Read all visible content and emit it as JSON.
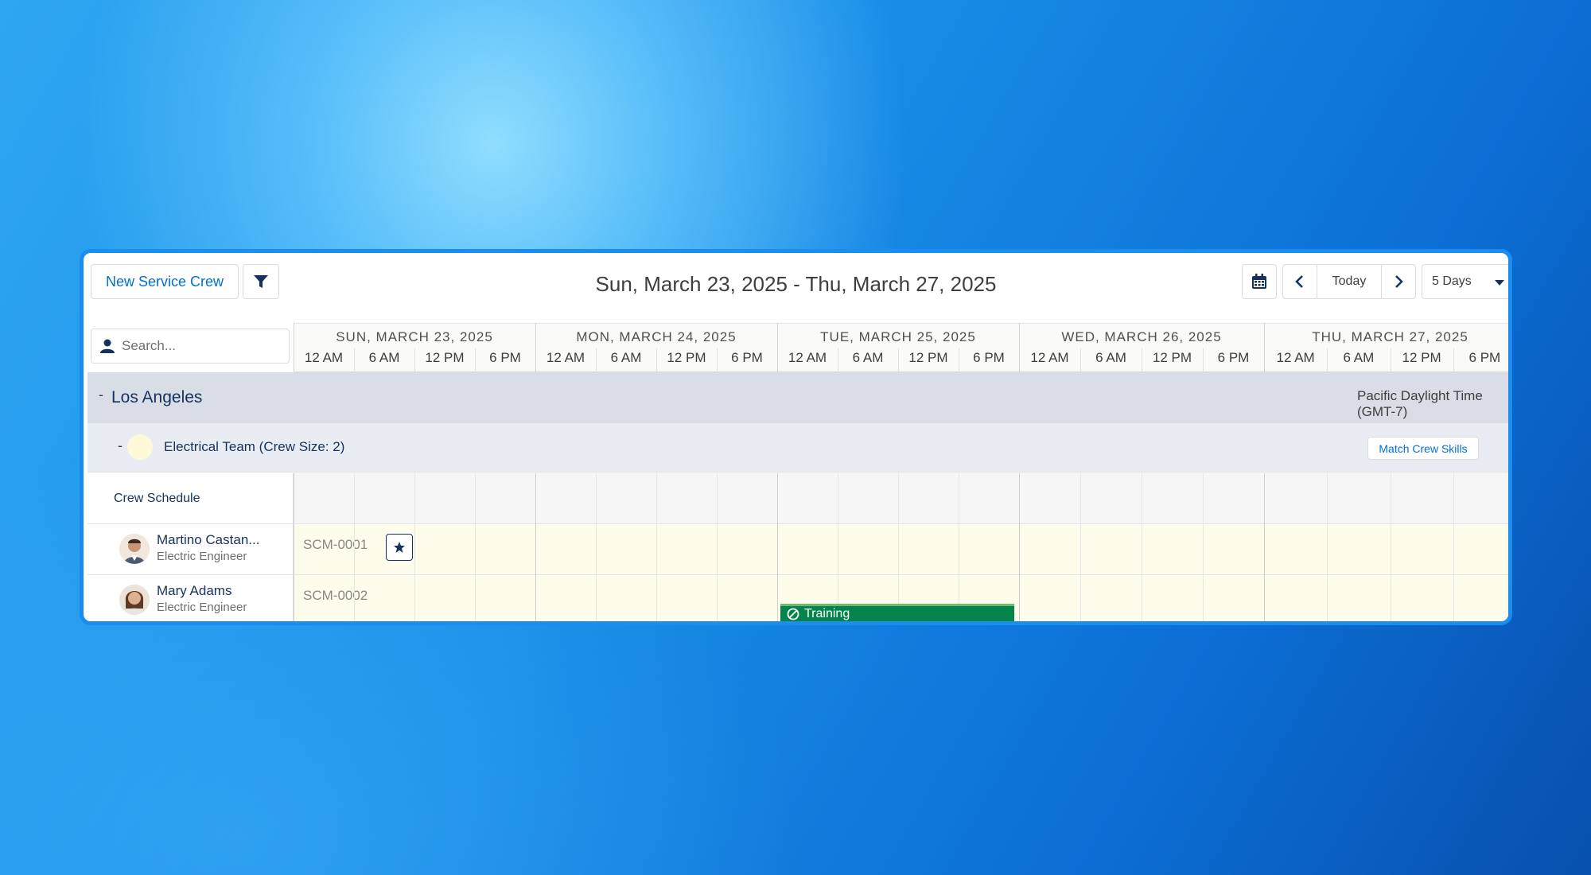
{
  "toolbar": {
    "new_crew_label": "New Service Crew",
    "date_range": "Sun, March 23, 2025 - Thu, March 27, 2025",
    "today_label": "Today",
    "view_label": "5 Days"
  },
  "search": {
    "placeholder": "Search..."
  },
  "days": [
    {
      "label": "SUN, MARCH 23, 2025"
    },
    {
      "label": "MON, MARCH 24, 2025"
    },
    {
      "label": "TUE, MARCH 25, 2025"
    },
    {
      "label": "WED, MARCH 26, 2025"
    },
    {
      "label": "THU, MARCH 27, 2025"
    }
  ],
  "hours": [
    "12 AM",
    "6 AM",
    "12 PM",
    "6 PM"
  ],
  "region": {
    "toggle": "-",
    "name": "Los Angeles",
    "timezone": "Pacific Daylight Time (GMT-7)"
  },
  "team": {
    "toggle": "-",
    "name": "Electrical Team (Crew Size: 2)",
    "match_label": "Match Crew Skills"
  },
  "crew_schedule_label": "Crew Schedule",
  "members": [
    {
      "name": "Martino Castan...",
      "role": "Electric Engineer",
      "code": "SCM-0001"
    },
    {
      "name": "Mary Adams",
      "role": "Electric Engineer",
      "code": "SCM-0002"
    }
  ],
  "event": {
    "label": "Training",
    "color": "#04844b"
  },
  "colors": {
    "accent": "#0070d2",
    "crew_row": "#fefcea",
    "frame": "#1b8df0"
  },
  "icons": {
    "filter": "filter-icon",
    "calendar": "calendar-icon",
    "prev": "chevron-left-icon",
    "next": "chevron-right-icon",
    "dropdown": "caret-down-icon",
    "star": "star-icon",
    "user": "user-icon",
    "blocked": "blocked-icon"
  }
}
